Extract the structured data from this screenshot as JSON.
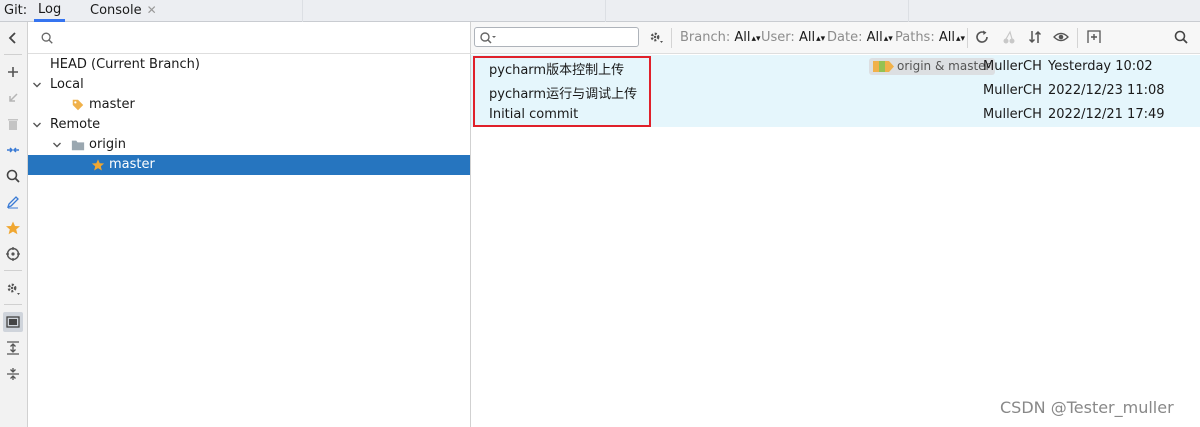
{
  "tabbar": {
    "git_label": "Git:",
    "tabs": [
      {
        "label": "Log",
        "active": true
      },
      {
        "label": "Console",
        "active": false,
        "close": "✕"
      }
    ]
  },
  "toolstrip": {
    "icons": [
      "chevron-left-icon",
      "plus-icon",
      "fetch-arrow-icon",
      "trash-icon",
      "merge-arrows-icon",
      "search-icon",
      "edit-icon",
      "star-icon",
      "target-icon",
      "settings-icon",
      "preview-panel-icon",
      "expand-all-icon",
      "collapse-all-icon"
    ]
  },
  "branches": {
    "search_placeholder": "",
    "tree": [
      {
        "label": "HEAD (Current Branch)",
        "level": 0,
        "expandable": false
      },
      {
        "label": "Local",
        "level": 0,
        "expandable": true
      },
      {
        "label": "master",
        "level": 1,
        "icon": "tag-icon"
      },
      {
        "label": "Remote",
        "level": 0,
        "expandable": true
      },
      {
        "label": "origin",
        "level": 1,
        "expandable": true,
        "icon": "folder-icon"
      },
      {
        "label": "master",
        "level": 2,
        "icon": "star-icon",
        "selected": true
      }
    ]
  },
  "log_toolbar": {
    "search_placeholder": "",
    "filters": [
      {
        "label": "Branch:",
        "value": "All"
      },
      {
        "label": "User:",
        "value": "All"
      },
      {
        "label": "Date:",
        "value": "All"
      },
      {
        "label": "Paths:",
        "value": "All"
      }
    ]
  },
  "commits": [
    {
      "message": "pycharm版本控制上传",
      "refs": "origin & master",
      "author": "MullerCH",
      "date": "Yesterday 10:02"
    },
    {
      "message": "pycharm运行与调试上传",
      "refs": "",
      "author": "MullerCH",
      "date": "2022/12/23 11:08"
    },
    {
      "message": "Initial commit",
      "refs": "",
      "author": "MullerCH",
      "date": "2022/12/21 17:49"
    }
  ],
  "colors": {
    "accent": "#3574f0",
    "selection": "#2675bf",
    "commit_row": "#e5f6fc",
    "graph": "#9c8b55",
    "highlight": "#e0202a"
  },
  "watermark": "CSDN @Tester_muller"
}
